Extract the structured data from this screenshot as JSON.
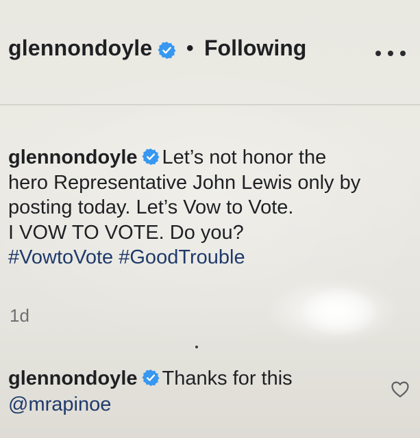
{
  "header": {
    "username": "glennondoyle",
    "separator": "•",
    "follow_status": "Following",
    "more_icon": "more-horizontal-icon"
  },
  "caption": {
    "username": "glennondoyle",
    "line1": "Let’s not honor the",
    "line2": "hero Representative John Lewis only by",
    "line3": "posting today. Let’s Vow to Vote.",
    "line4": "I VOW TO VOTE. Do you?",
    "hashtag1": "#VowtoVote",
    "hashtag2": "#GoodTrouble"
  },
  "timestamp": "1d",
  "comment": {
    "username": "glennondoyle",
    "text": "Thanks for this",
    "mention": "@mrapinoe",
    "like_icon": "heart-outline-icon"
  },
  "colors": {
    "verified_badge": "#3897f0",
    "text": "#1e2023",
    "hashtag": "#1f3a6b",
    "timestamp": "#6e7073"
  }
}
